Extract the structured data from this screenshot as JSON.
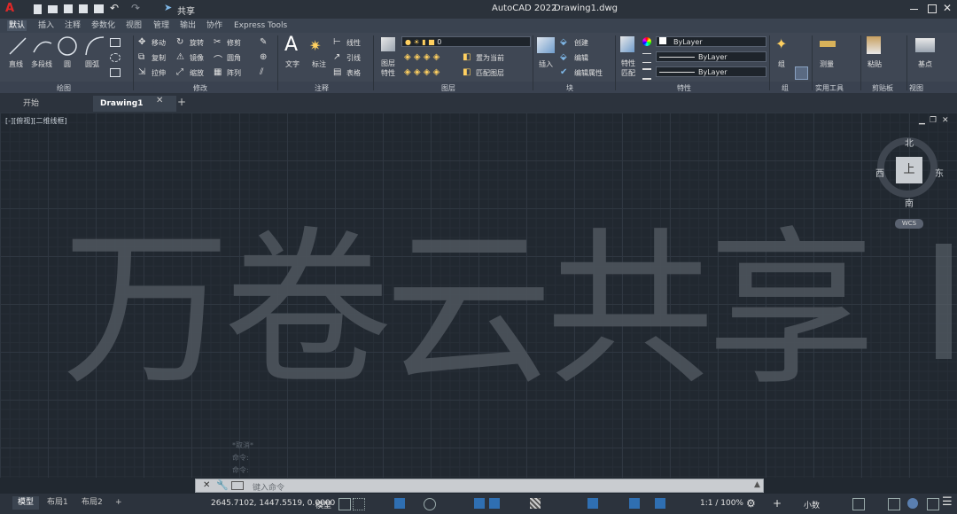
{
  "titlebar": {
    "app_title": "AutoCAD 2022",
    "file_name": "Drawing1.dwg",
    "share_label": "共享"
  },
  "ribbon_tabs": [
    "默认",
    "插入",
    "注释",
    "参数化",
    "视图",
    "管理",
    "输出",
    "协作",
    "Express Tools"
  ],
  "ribbon": {
    "draw": {
      "line": "直线",
      "polyline": "多段线",
      "circle": "圆",
      "arc": "圆弧",
      "title": "绘图"
    },
    "modify": {
      "move": "移动",
      "rotate": "旋转",
      "trim": "修剪",
      "copy": "复制",
      "mirror": "镜像",
      "fillet": "圆角",
      "stretch": "拉伸",
      "scale": "缩放",
      "array": "阵列",
      "title": "修改"
    },
    "annotation": {
      "text": "文字",
      "dimension": "标注",
      "linear": "线性",
      "leader": "引线",
      "table": "表格",
      "title": "注释"
    },
    "layers": {
      "layer_props": "图层",
      "layer_props_2": "特性",
      "current_layer": "0",
      "set_current": "置为当前",
      "match_layer": "匹配图层",
      "title": "图层"
    },
    "block": {
      "insert": "插入",
      "create": "创建",
      "edit": "编辑",
      "edit_attr": "编辑属性",
      "title": "块"
    },
    "properties": {
      "match": "特性",
      "match_2": "匹配",
      "color": "ByLayer",
      "linetype": "ByLayer",
      "lineweight": "ByLayer",
      "title": "特性"
    },
    "groups": {
      "group": "组",
      "title": "组"
    },
    "utilities": {
      "measure": "测量",
      "title": "实用工具"
    },
    "clipboard": {
      "paste": "粘贴",
      "title": "剪贴板"
    },
    "view": {
      "base": "基点",
      "title": "视图"
    }
  },
  "doc_tabs": {
    "start": "开始",
    "drawing": "Drawing1"
  },
  "viewport": {
    "label": "[-][俯视][二维线框]",
    "cube": {
      "north": "北",
      "south": "南",
      "east": "东",
      "west": "西",
      "face": "上",
      "wcs": "WCS"
    },
    "watermark": "万卷云共享"
  },
  "command": {
    "history": [
      "*取消*",
      "命令:",
      "命令:"
    ],
    "placeholder": "键入命令"
  },
  "status": {
    "layout_tabs": [
      "模型",
      "布局1",
      "布局2"
    ],
    "coords": "2645.7102, 1447.5519, 0.0000",
    "model_label": "模型",
    "scale": "1:1 / 100%",
    "units": "小数"
  },
  "colors": {
    "accent": "#1f8de0",
    "ribbon": "#3f4754",
    "canvas": "#212830"
  }
}
